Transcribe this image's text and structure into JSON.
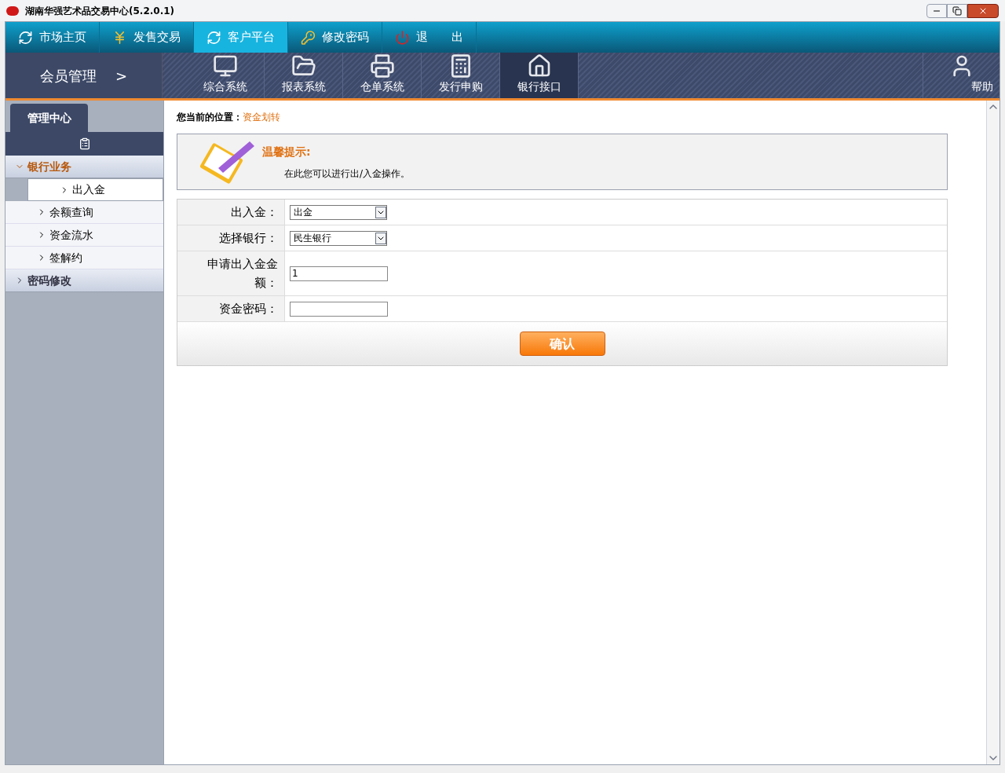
{
  "window": {
    "title": "湖南华强艺术品交易中心(5.2.0.1)"
  },
  "top_nav": [
    {
      "label": "市场主页",
      "selected": false
    },
    {
      "label": "发售交易",
      "selected": false
    },
    {
      "label": "客户平台",
      "selected": true
    },
    {
      "label": "修改密码",
      "selected": false
    },
    {
      "label": "退　　出",
      "selected": false
    }
  ],
  "section": {
    "title": "会员管理",
    "arrow": ">"
  },
  "systems": [
    {
      "label": "综合系统",
      "selected": false
    },
    {
      "label": "报表系统",
      "selected": false
    },
    {
      "label": "仓单系统",
      "selected": false
    },
    {
      "label": "发行申购",
      "selected": false
    },
    {
      "label": "银行接口",
      "selected": true
    }
  ],
  "help": {
    "label": "帮助"
  },
  "sidebar": {
    "tab": "管理中心",
    "groups": [
      {
        "label": "银行业务",
        "expanded": true,
        "children": [
          {
            "label": "出入金",
            "selected": true
          },
          {
            "label": "余额查询",
            "selected": false
          },
          {
            "label": "资金流水",
            "selected": false
          },
          {
            "label": "签解约",
            "selected": false
          }
        ]
      },
      {
        "label": "密码修改",
        "expanded": false
      }
    ]
  },
  "breadcrumb": {
    "label": "您当前的位置：",
    "value": "资金划转"
  },
  "tip": {
    "title": "温馨提示:",
    "text": "在此您可以进行出/入金操作。"
  },
  "form": {
    "rows": [
      {
        "label": "出入金：",
        "kind": "select",
        "value": "出金"
      },
      {
        "label": "选择银行：",
        "kind": "select",
        "value": "民生银行"
      },
      {
        "label": "申请出入金金额：",
        "kind": "input",
        "value": "1"
      },
      {
        "label": "资金密码：",
        "kind": "password",
        "value": ""
      }
    ],
    "submit": "确认"
  }
}
